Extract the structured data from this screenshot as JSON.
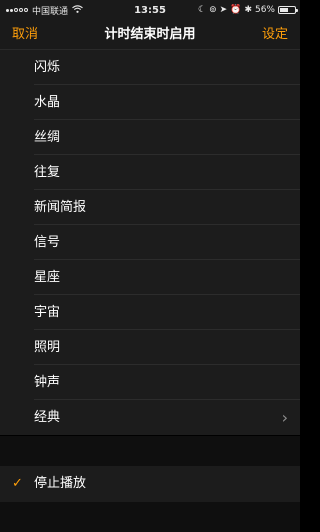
{
  "status_bar": {
    "carrier": "中国联通",
    "time": "13:55",
    "battery_percent": "56%",
    "battery_level": 0.56
  },
  "nav": {
    "cancel": "取消",
    "title": "计时结束时启用",
    "set": "设定"
  },
  "sounds": [
    {
      "label": "闪烁"
    },
    {
      "label": "水晶"
    },
    {
      "label": "丝绸"
    },
    {
      "label": "往复"
    },
    {
      "label": "新闻简报"
    },
    {
      "label": "信号"
    },
    {
      "label": "星座"
    },
    {
      "label": "宇宙"
    },
    {
      "label": "照明"
    },
    {
      "label": "钟声"
    },
    {
      "label": "经典"
    }
  ],
  "stop_playing": {
    "label": "停止播放",
    "selected": true
  },
  "colors": {
    "accent": "#ff9f0a",
    "background": "#1c1c1c"
  }
}
